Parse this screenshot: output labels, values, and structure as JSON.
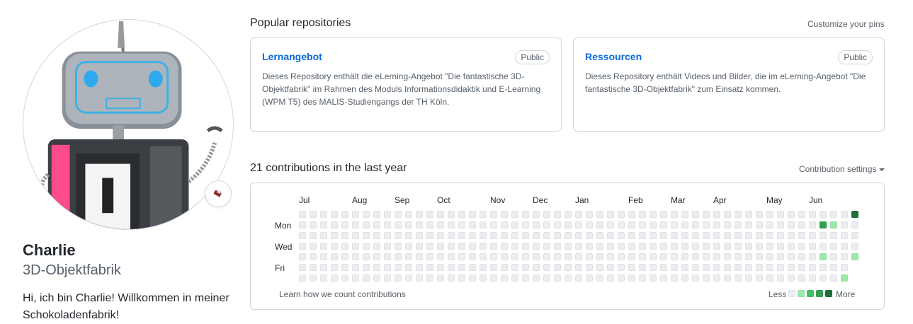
{
  "profile": {
    "name": "Charlie",
    "login": "3D-Objektfabrik",
    "bio": "Hi, ich bin Charlie! Willkommen in meiner Schokoladenfabrik!",
    "avatar_icon": "robot-avatar-icon",
    "status_icon": "chocolate-emoji-icon"
  },
  "pinned": {
    "title": "Popular repositories",
    "customize_label": "Customize your pins",
    "repos": [
      {
        "name": "Lernangebot",
        "visibility": "Public",
        "description": "Dieses Repository enthält die eLerning-Angebot \"Die fantastische 3D-Objektfabrik\" im Rahmen des Moduls Informationsdidaktik und E-Learning (WPM T5) des MALIS-Studiengangs der TH Köln."
      },
      {
        "name": "Ressourcen",
        "visibility": "Public",
        "description": "Dieses Repository enthält Videos und Bilder, die im eLerning-Angebot \"Die fantastische 3D-Objektfabrik\" zum Einsatz kommen."
      }
    ]
  },
  "contributions": {
    "title": "21 contributions in the last year",
    "settings_label": "Contribution settings",
    "months": [
      "Jul",
      "Aug",
      "Sep",
      "Oct",
      "Nov",
      "Dec",
      "Jan",
      "Feb",
      "Mar",
      "Apr",
      "May",
      "Jun"
    ],
    "day_labels": [
      "Mon",
      "Wed",
      "Fri"
    ],
    "learn_label": "Learn how we count contributions",
    "legend_less": "Less",
    "legend_more": "More",
    "colors": [
      "#ebedf0",
      "#9be9a8",
      "#40c463",
      "#30a14e",
      "#216e39"
    ],
    "weeks": 53,
    "last_week_days": 5,
    "active_cells": [
      {
        "week": 49,
        "day": 1,
        "level": 3
      },
      {
        "week": 49,
        "day": 4,
        "level": 1
      },
      {
        "week": 50,
        "day": 1,
        "level": 1
      },
      {
        "week": 51,
        "day": 6,
        "level": 1
      },
      {
        "week": 52,
        "day": 0,
        "level": 4
      },
      {
        "week": 52,
        "day": 4,
        "level": 1
      }
    ]
  }
}
